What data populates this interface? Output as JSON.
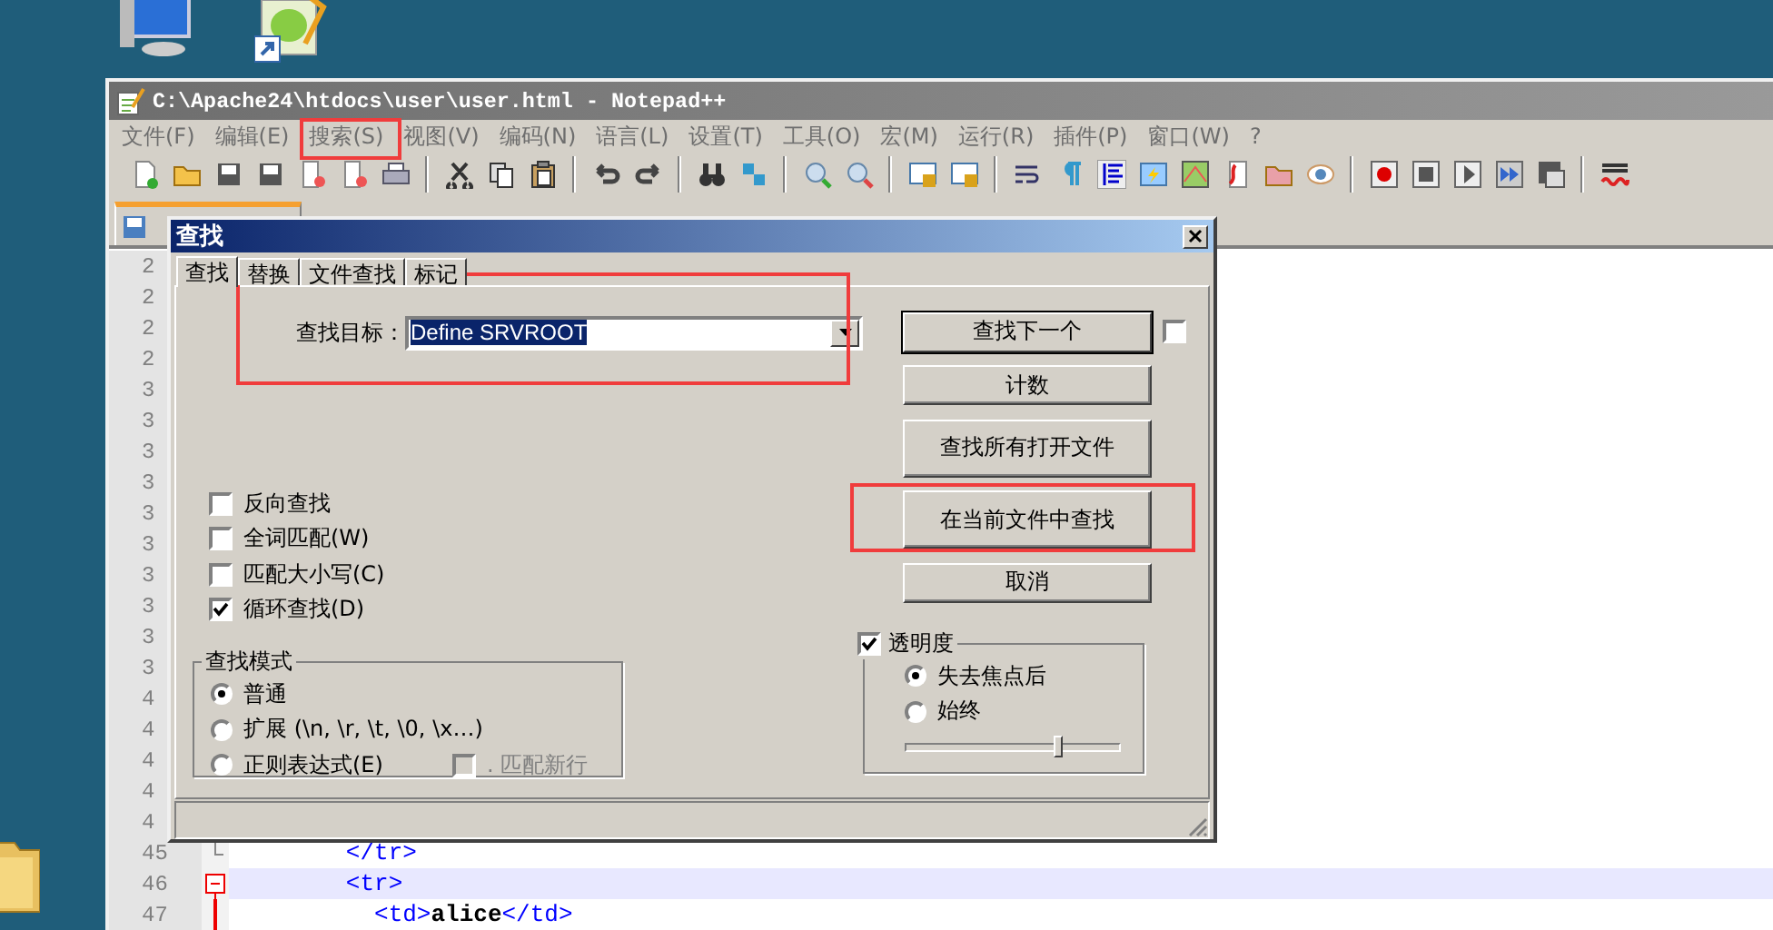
{
  "window": {
    "title": "C:\\Apache24\\htdocs\\user\\user.html - Notepad++"
  },
  "menu": [
    "文件(F)",
    "编辑(E)",
    "搜索(S)",
    "视图(V)",
    "编码(N)",
    "语言(L)",
    "设置(T)",
    "工具(O)",
    "宏(M)",
    "运行(R)",
    "插件(P)",
    "窗口(W)",
    "?"
  ],
  "editor": {
    "lines": [
      {
        "number": "2",
        "current": false
      },
      {
        "number": "2",
        "current": false
      },
      {
        "number": "2",
        "current": false
      },
      {
        "number": "2",
        "current": false
      },
      {
        "number": "3",
        "current": false
      },
      {
        "number": "3",
        "current": false
      },
      {
        "number": "3",
        "current": false
      },
      {
        "number": "3",
        "current": false
      },
      {
        "number": "3",
        "current": false
      },
      {
        "number": "3",
        "current": false
      },
      {
        "number": "3",
        "current": false
      },
      {
        "number": "3",
        "current": false
      },
      {
        "number": "3",
        "current": false
      },
      {
        "number": "3",
        "current": false
      },
      {
        "number": "4",
        "current": false
      },
      {
        "number": "4",
        "current": false
      },
      {
        "number": "4",
        "current": false
      },
      {
        "number": "4",
        "current": false
      },
      {
        "number": "4",
        "current": false
      },
      {
        "number": "45",
        "current": false,
        "kind": "fold_end",
        "code": "        </tr>"
      },
      {
        "number": "46",
        "current": true,
        "kind": "fold_open",
        "code": "        <tr>"
      },
      {
        "number": "47",
        "current": false,
        "kind": "fold_line",
        "code": "          <td>alice</td>"
      }
    ]
  },
  "find_dialog": {
    "title": "查找",
    "tabs": [
      {
        "label": "查找",
        "selected": true
      },
      {
        "label": "替换",
        "selected": false
      },
      {
        "label": "文件查找",
        "selected": false
      },
      {
        "label": "标记",
        "selected": false
      }
    ],
    "find_label": "查找目标：",
    "find_value": "Define SRVROOT",
    "side_checkbox": {
      "checked": false
    },
    "buttons": [
      {
        "label": "查找下一个",
        "kind": "default"
      },
      {
        "label": "计数",
        "kind": "normal"
      },
      {
        "label": "查找所有打开文件",
        "kind": "large"
      },
      {
        "label": "在当前文件中查找",
        "kind": "large"
      },
      {
        "label": "取消",
        "kind": "normal"
      }
    ],
    "options": [
      {
        "label": "反向查找",
        "checked": false
      },
      {
        "label": "全词匹配(W)",
        "checked": false
      },
      {
        "label": "匹配大小写(C)",
        "checked": false
      },
      {
        "label": "循环查找(D)",
        "checked": true
      }
    ],
    "search_mode": {
      "title": "查找模式",
      "options": [
        {
          "label": "普通",
          "selected": true
        },
        {
          "label": "扩展 (\\n, \\r, \\t, \\0, \\x…)",
          "selected": false
        },
        {
          "label": "正则表达式(E)",
          "selected": false
        }
      ],
      "dot_newline": {
        "label": ". 匹配新行",
        "checked": false,
        "disabled": true
      }
    },
    "transparency": {
      "label": "透明度",
      "checked": true,
      "options": [
        {
          "label": "失去焦点后",
          "selected": true
        },
        {
          "label": "始终",
          "selected": false
        }
      ],
      "level": 0.72
    }
  }
}
